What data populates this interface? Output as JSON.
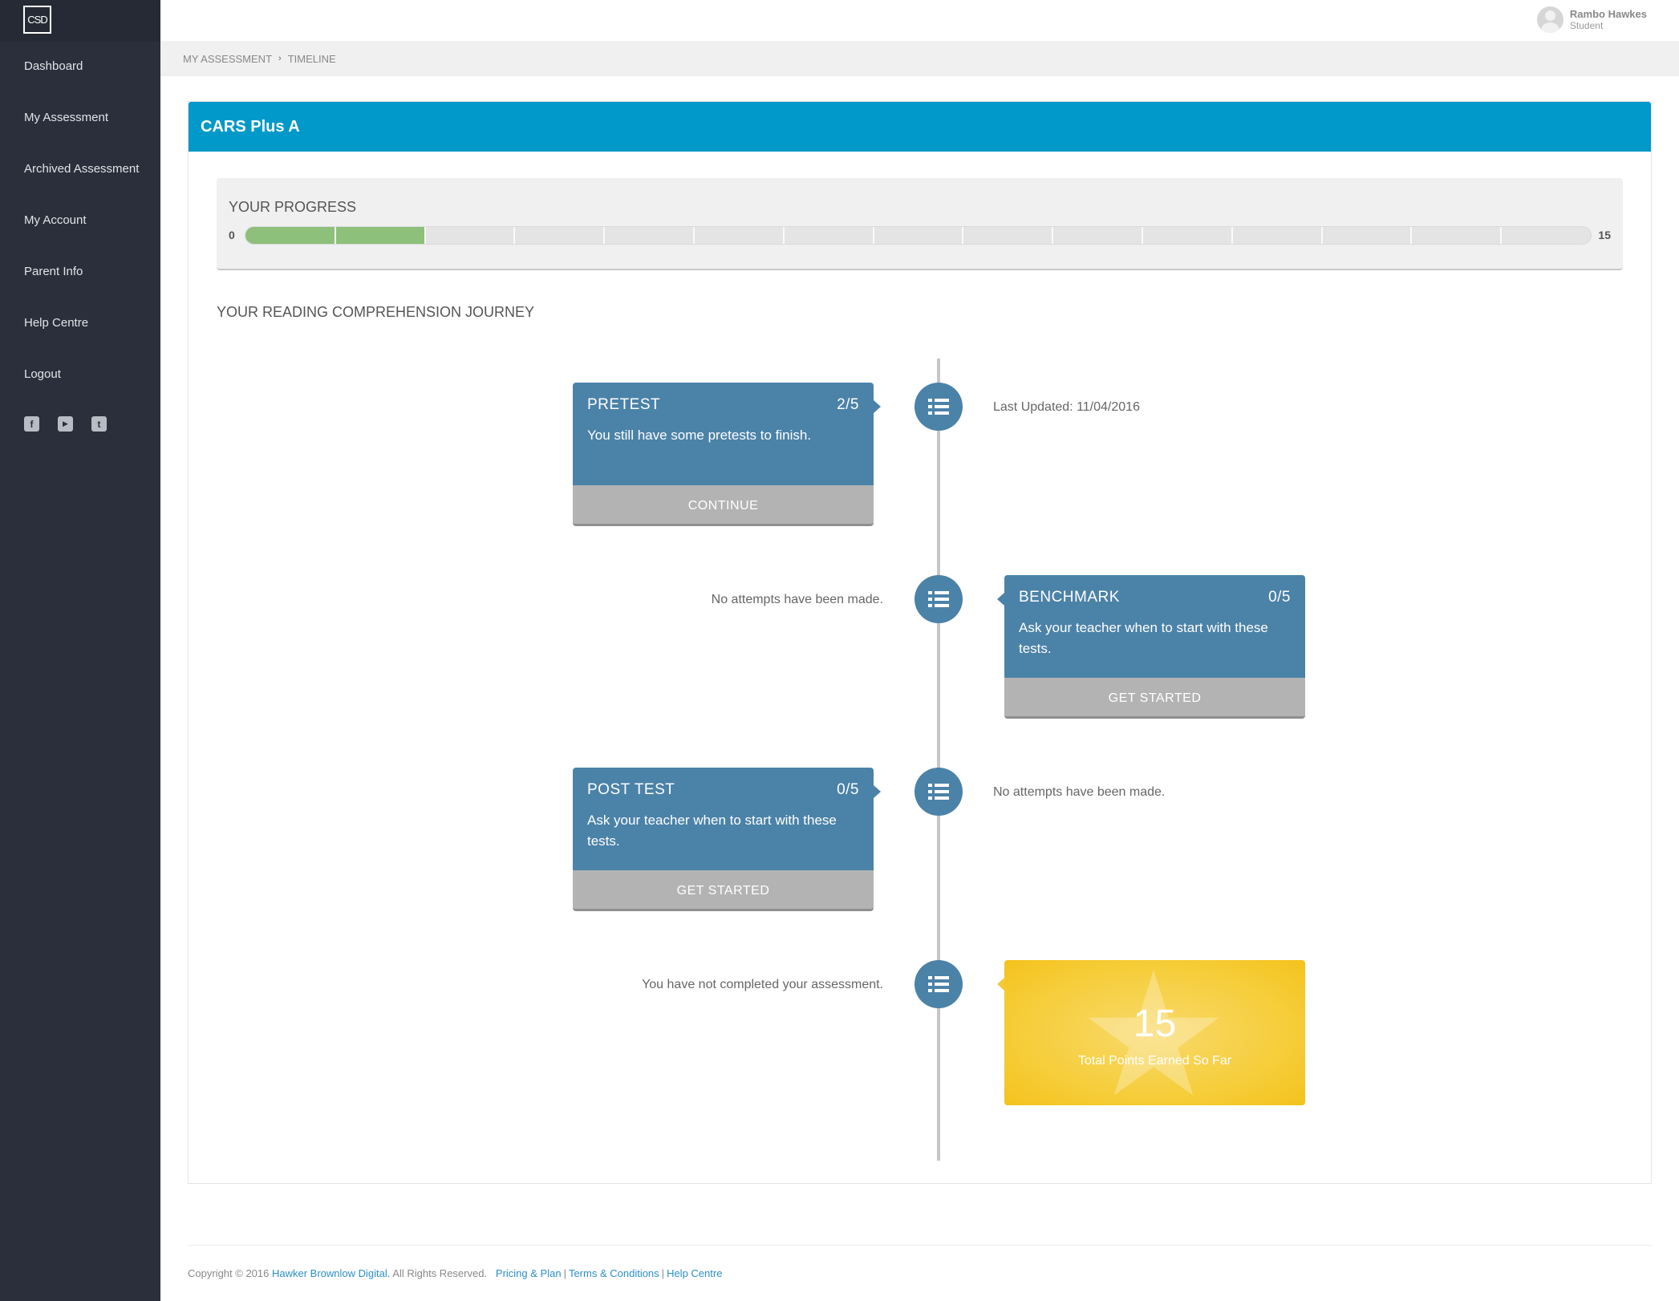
{
  "sidebar": {
    "logo": "CSD",
    "items": [
      {
        "label": "Dashboard"
      },
      {
        "label": "My Assessment"
      },
      {
        "label": "Archived Assessment"
      },
      {
        "label": "My Account"
      },
      {
        "label": "Parent Info"
      },
      {
        "label": "Help Centre"
      },
      {
        "label": "Logout"
      }
    ],
    "socials": [
      {
        "icon": "facebook-icon",
        "glyph": "f"
      },
      {
        "icon": "youtube-icon",
        "glyph": "▶"
      },
      {
        "icon": "twitter-icon",
        "glyph": "t"
      }
    ]
  },
  "user": {
    "name": "Rambo Hawkes",
    "role": "Student"
  },
  "breadcrumb": {
    "items": [
      "MY ASSESSMENT",
      "TIMELINE"
    ]
  },
  "panel": {
    "title": "CARS Plus A"
  },
  "progress": {
    "title": "YOUR PROGRESS",
    "min": "0",
    "max": "15",
    "completed": 2,
    "total": 15,
    "fill_color": "#8dc07a"
  },
  "journey": {
    "title": "YOUR READING COMPREHENSION JOURNEY",
    "stages": [
      {
        "name": "PRETEST",
        "score": "2/5",
        "text": "You still have some pretests to finish.",
        "button": "CONTINUE",
        "note": "Last Updated: 11/04/2016"
      },
      {
        "name": "BENCHMARK",
        "score": "0/5",
        "text": "Ask your teacher when to start with these tests.",
        "button": "GET STARTED",
        "note": "No attempts have been made."
      },
      {
        "name": "POST TEST",
        "score": "0/5",
        "text": "Ask your teacher when to start with these tests.",
        "button": "GET STARTED",
        "note": "No attempts have been made."
      }
    ],
    "final": {
      "note": "You have not completed your assessment.",
      "points": "15",
      "points_label": "Total Points Earned So Far"
    }
  },
  "footer": {
    "copyright": "Copyright © 2016",
    "company": "Hawker Brownlow Digital.",
    "rights": "All Rights Reserved.",
    "links": [
      "Pricing & Plan",
      "Terms & Conditions",
      "Help Centre"
    ]
  },
  "colors": {
    "header": "#0199c9",
    "card": "#4b82a8",
    "sidebar": "#2a2f3b",
    "gold": "#f6cf40"
  }
}
